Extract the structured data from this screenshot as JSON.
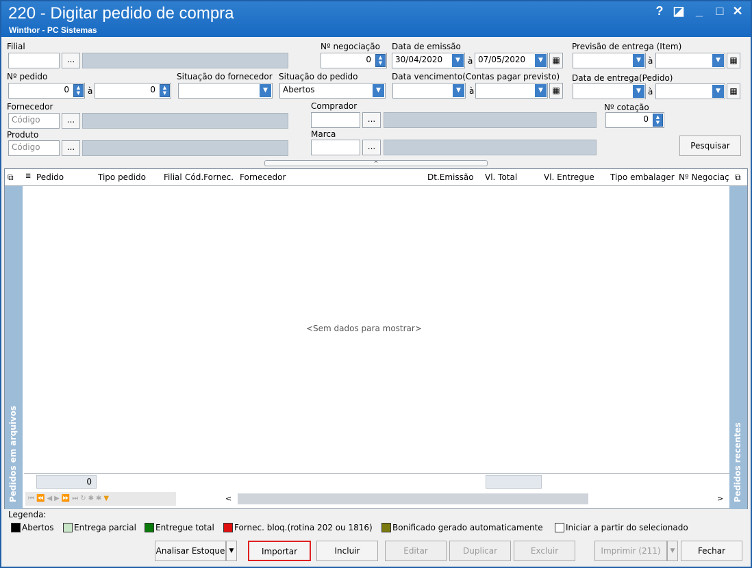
{
  "window": {
    "title": "220 - Digitar pedido de compra",
    "subtitle": "Winthor - PC Sistemas",
    "controls": {
      "help": "?",
      "restore": "◪",
      "minimize": "_",
      "maximize": "□",
      "close": "✕"
    }
  },
  "filters": {
    "filial_label": "Filial",
    "negociacao_label": "Nº negociação",
    "negociacao_value": "0",
    "data_emissao_label": "Data de emissão",
    "data_emissao_from": "30/04/2020",
    "a_label": "à",
    "data_emissao_to": "07/05/2020",
    "previsao_label": "Previsão  de entrega (Item)",
    "pedido_label": "Nº pedido",
    "pedido_from": "0",
    "pedido_to": "0",
    "sit_fornecedor_label": "Situação do fornecedor",
    "sit_pedido_label": "Situação do pedido",
    "sit_pedido_value": "Abertos",
    "data_venc_label": "Data vencimento(Contas pagar previsto)",
    "data_entrega_label": "Data de entrega(Pedido)",
    "fornecedor_label": "Fornecedor",
    "codigo_placeholder": "Código",
    "comprador_label": "Comprador",
    "cotacao_label": "Nº cotação",
    "cotacao_value": "0",
    "produto_label": "Produto",
    "marca_label": "Marca",
    "dots": "...",
    "pesquisar": "Pesquisar"
  },
  "grid": {
    "columns": [
      "Pedido",
      "Tipo pedido",
      "Filial",
      "Cód.Fornec.",
      "Fornecedor",
      "Dt.Emissão",
      "Vl. Total",
      "Vl. Entregue",
      "Tipo embalager",
      "Nº Negociaç"
    ],
    "empty_text": "<Sem dados para mostrar>",
    "footer_count": "0",
    "left_panel": "Pedidos em arquivos",
    "right_panel": "Pedidos recentes"
  },
  "legend": {
    "title": "Legenda:",
    "items": [
      {
        "label": "Abertos",
        "color": "#000000"
      },
      {
        "label": "Entrega parcial",
        "color": "#c9e6c9"
      },
      {
        "label": "Entregue total",
        "color": "#0a7a0a"
      },
      {
        "label": "Fornec. bloq.(rotina 202 ou 1816)",
        "color": "#e01010"
      },
      {
        "label": "Bonificado gerado automaticamente",
        "color": "#7a7a10"
      },
      {
        "label": "Iniciar a partir do selecionado",
        "color": "#ffffff"
      }
    ]
  },
  "buttons": {
    "analisar": "Analisar Estoque",
    "importar": "Importar",
    "incluir": "Incluir",
    "editar": "Editar",
    "duplicar": "Duplicar",
    "excluir": "Excluir",
    "imprimir": "Imprimir (211)",
    "fechar": "Fechar"
  }
}
